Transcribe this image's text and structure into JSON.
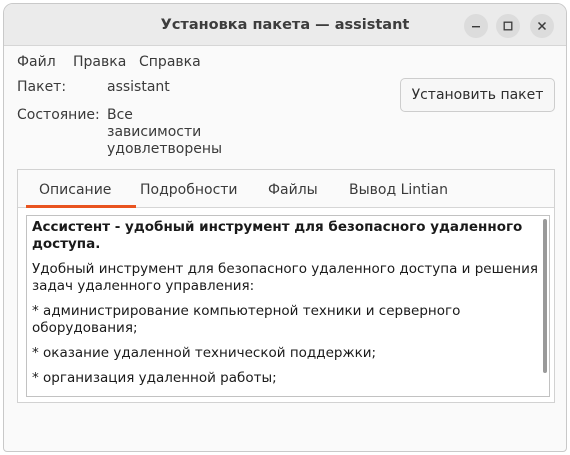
{
  "window": {
    "title": "Установка пакета — assistant"
  },
  "menu": {
    "items": [
      "Файл",
      "Правка",
      "Справка"
    ]
  },
  "info": {
    "package_label": "Пакет:",
    "package_value": "assistant",
    "status_label": "Состояние:",
    "status_lines": [
      "Все",
      "зависимости",
      "удовлетворены"
    ]
  },
  "actions": {
    "install_label": "Установить пакет"
  },
  "tabs": {
    "items": [
      "Описание",
      "Подробности",
      "Файлы",
      "Вывод Lintian"
    ],
    "active": "Описание"
  },
  "description": {
    "headline": "Ассистент - удобный инструмент для безопасного удаленного доступа.",
    "paragraphs": [
      "Удобный инструмент для безопасного удаленного доступа и решения задач удаленного управления:",
      "* администрирование компьютерной техники и серверного оборудования;",
      "* оказание удаленной технической поддержки;",
      "* организация удаленной работы;"
    ]
  },
  "colors": {
    "accent": "#e95420",
    "titlebar": "#ebebeb"
  },
  "icons": [
    "minimize-icon",
    "maximize-icon",
    "close-icon"
  ]
}
